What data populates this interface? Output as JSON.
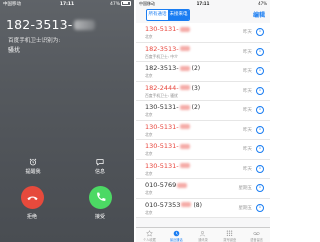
{
  "incoming": {
    "status_left": "中国移动",
    "status_time": "17:11",
    "status_battery": "47%",
    "phone_number": "182-3513-",
    "identified_by": "百度手机卫士识别为:",
    "tag": "骚扰",
    "remind_label": "提醒我",
    "message_label": "信息",
    "decline_label": "拒绝",
    "accept_label": "接受",
    "decline_color": "#e64a3c",
    "accept_color": "#4cd964"
  },
  "log": {
    "status_left": "中国移动",
    "status_time": "17:11",
    "status_battery": "47%",
    "tabs": [
      "所有通话",
      "未接来电"
    ],
    "edit_label": "编辑",
    "accent_color": "#1a7df2",
    "missed_color": "#e8453c",
    "rows": [
      {
        "number": "130-5131-",
        "count": "",
        "location": "北京",
        "time": "昨天",
        "missed": true
      },
      {
        "number": "182-3513-",
        "count": "",
        "location": "百度手机卫士: 中介",
        "time": "昨天",
        "missed": true
      },
      {
        "number": "182-3513-",
        "count": "(2)",
        "location": "北京",
        "time": "昨天",
        "missed": false
      },
      {
        "number": "182-2444-",
        "count": "(3)",
        "location": "百度手机卫士: 骚扰",
        "time": "昨天",
        "missed": true
      },
      {
        "number": "130-5131-",
        "count": "(2)",
        "location": "北京",
        "time": "昨天",
        "missed": false
      },
      {
        "number": "130-5131-",
        "count": "",
        "location": "北京",
        "time": "昨天",
        "missed": true
      },
      {
        "number": "130-5131-",
        "count": "",
        "location": "北京",
        "time": "昨天",
        "missed": true
      },
      {
        "number": "130-5131-",
        "count": "",
        "location": "北京",
        "time": "昨天",
        "missed": true
      },
      {
        "number": "010-5769",
        "count": "",
        "location": "北京",
        "time": "星期五",
        "missed": false
      },
      {
        "number": "010-57353",
        "count": "(8)",
        "location": "北京",
        "time": "星期五",
        "missed": false
      }
    ],
    "tabbar": [
      {
        "label": "个人收藏",
        "icon": "star-icon"
      },
      {
        "label": "最近通话",
        "icon": "clock-icon",
        "active": true
      },
      {
        "label": "通讯录",
        "icon": "contacts-icon"
      },
      {
        "label": "拨号键盘",
        "icon": "keypad-icon"
      },
      {
        "label": "语音留言",
        "icon": "voicemail-icon"
      }
    ]
  }
}
